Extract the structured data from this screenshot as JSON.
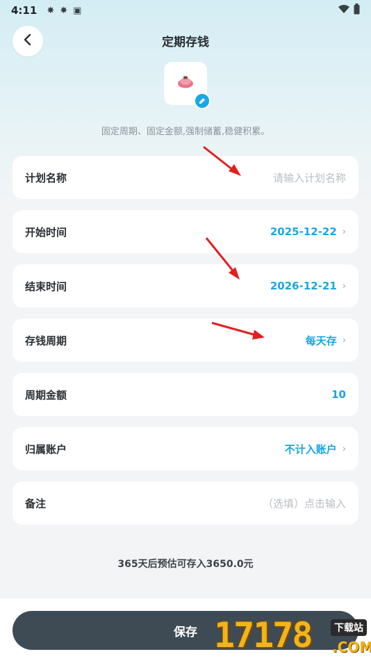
{
  "status_bar": {
    "time": "4:11",
    "left_icons": [
      "gear-icon",
      "gear-icon",
      "a-icon"
    ],
    "right_icons": [
      "wifi-icon",
      "battery-icon"
    ]
  },
  "header": {
    "title": "定期存钱"
  },
  "plan": {
    "icon": "piggy-bank-icon",
    "subtitle": "固定周期、固定金额,强制储蓄,稳健积累。"
  },
  "form": {
    "name": {
      "label": "计划名称",
      "placeholder": "请输入计划名称"
    },
    "start": {
      "label": "开始时间",
      "value": "2025-12-22"
    },
    "end": {
      "label": "结束时间",
      "value": "2026-12-21"
    },
    "period": {
      "label": "存钱周期",
      "value": "每天存"
    },
    "amount": {
      "label": "周期金额",
      "value": "10"
    },
    "account": {
      "label": "归属账户",
      "value": "不计入账户"
    },
    "note": {
      "label": "备注",
      "placeholder": "（选填）点击输入"
    }
  },
  "estimate": "365天后预估可存入3650.0元",
  "save_label": "保存",
  "watermark": {
    "number": "17178",
    "tag": "下载站",
    "com": ".COM"
  },
  "colors": {
    "accent": "#1aa6e0",
    "save_button": "#3e4a54",
    "arrow": "#e02020"
  }
}
